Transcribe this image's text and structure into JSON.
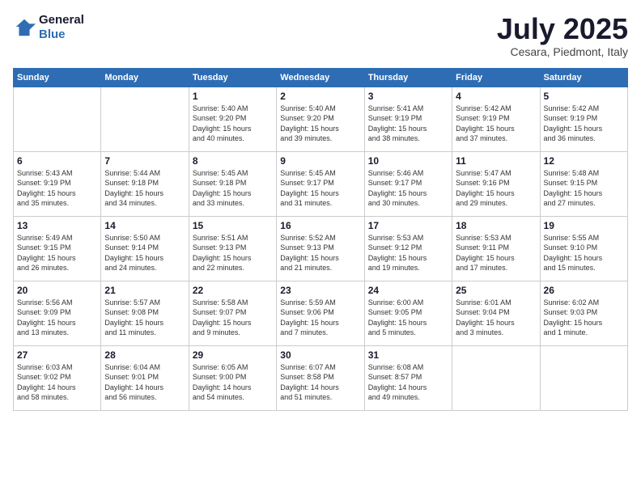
{
  "logo": {
    "line1": "General",
    "line2": "Blue"
  },
  "calendar": {
    "title": "July 2025",
    "subtitle": "Cesara, Piedmont, Italy"
  },
  "headers": [
    "Sunday",
    "Monday",
    "Tuesday",
    "Wednesday",
    "Thursday",
    "Friday",
    "Saturday"
  ],
  "weeks": [
    [
      {
        "day": "",
        "info": ""
      },
      {
        "day": "",
        "info": ""
      },
      {
        "day": "1",
        "info": "Sunrise: 5:40 AM\nSunset: 9:20 PM\nDaylight: 15 hours\nand 40 minutes."
      },
      {
        "day": "2",
        "info": "Sunrise: 5:40 AM\nSunset: 9:20 PM\nDaylight: 15 hours\nand 39 minutes."
      },
      {
        "day": "3",
        "info": "Sunrise: 5:41 AM\nSunset: 9:19 PM\nDaylight: 15 hours\nand 38 minutes."
      },
      {
        "day": "4",
        "info": "Sunrise: 5:42 AM\nSunset: 9:19 PM\nDaylight: 15 hours\nand 37 minutes."
      },
      {
        "day": "5",
        "info": "Sunrise: 5:42 AM\nSunset: 9:19 PM\nDaylight: 15 hours\nand 36 minutes."
      }
    ],
    [
      {
        "day": "6",
        "info": "Sunrise: 5:43 AM\nSunset: 9:19 PM\nDaylight: 15 hours\nand 35 minutes."
      },
      {
        "day": "7",
        "info": "Sunrise: 5:44 AM\nSunset: 9:18 PM\nDaylight: 15 hours\nand 34 minutes."
      },
      {
        "day": "8",
        "info": "Sunrise: 5:45 AM\nSunset: 9:18 PM\nDaylight: 15 hours\nand 33 minutes."
      },
      {
        "day": "9",
        "info": "Sunrise: 5:45 AM\nSunset: 9:17 PM\nDaylight: 15 hours\nand 31 minutes."
      },
      {
        "day": "10",
        "info": "Sunrise: 5:46 AM\nSunset: 9:17 PM\nDaylight: 15 hours\nand 30 minutes."
      },
      {
        "day": "11",
        "info": "Sunrise: 5:47 AM\nSunset: 9:16 PM\nDaylight: 15 hours\nand 29 minutes."
      },
      {
        "day": "12",
        "info": "Sunrise: 5:48 AM\nSunset: 9:15 PM\nDaylight: 15 hours\nand 27 minutes."
      }
    ],
    [
      {
        "day": "13",
        "info": "Sunrise: 5:49 AM\nSunset: 9:15 PM\nDaylight: 15 hours\nand 26 minutes."
      },
      {
        "day": "14",
        "info": "Sunrise: 5:50 AM\nSunset: 9:14 PM\nDaylight: 15 hours\nand 24 minutes."
      },
      {
        "day": "15",
        "info": "Sunrise: 5:51 AM\nSunset: 9:13 PM\nDaylight: 15 hours\nand 22 minutes."
      },
      {
        "day": "16",
        "info": "Sunrise: 5:52 AM\nSunset: 9:13 PM\nDaylight: 15 hours\nand 21 minutes."
      },
      {
        "day": "17",
        "info": "Sunrise: 5:53 AM\nSunset: 9:12 PM\nDaylight: 15 hours\nand 19 minutes."
      },
      {
        "day": "18",
        "info": "Sunrise: 5:53 AM\nSunset: 9:11 PM\nDaylight: 15 hours\nand 17 minutes."
      },
      {
        "day": "19",
        "info": "Sunrise: 5:55 AM\nSunset: 9:10 PM\nDaylight: 15 hours\nand 15 minutes."
      }
    ],
    [
      {
        "day": "20",
        "info": "Sunrise: 5:56 AM\nSunset: 9:09 PM\nDaylight: 15 hours\nand 13 minutes."
      },
      {
        "day": "21",
        "info": "Sunrise: 5:57 AM\nSunset: 9:08 PM\nDaylight: 15 hours\nand 11 minutes."
      },
      {
        "day": "22",
        "info": "Sunrise: 5:58 AM\nSunset: 9:07 PM\nDaylight: 15 hours\nand 9 minutes."
      },
      {
        "day": "23",
        "info": "Sunrise: 5:59 AM\nSunset: 9:06 PM\nDaylight: 15 hours\nand 7 minutes."
      },
      {
        "day": "24",
        "info": "Sunrise: 6:00 AM\nSunset: 9:05 PM\nDaylight: 15 hours\nand 5 minutes."
      },
      {
        "day": "25",
        "info": "Sunrise: 6:01 AM\nSunset: 9:04 PM\nDaylight: 15 hours\nand 3 minutes."
      },
      {
        "day": "26",
        "info": "Sunrise: 6:02 AM\nSunset: 9:03 PM\nDaylight: 15 hours\nand 1 minute."
      }
    ],
    [
      {
        "day": "27",
        "info": "Sunrise: 6:03 AM\nSunset: 9:02 PM\nDaylight: 14 hours\nand 58 minutes."
      },
      {
        "day": "28",
        "info": "Sunrise: 6:04 AM\nSunset: 9:01 PM\nDaylight: 14 hours\nand 56 minutes."
      },
      {
        "day": "29",
        "info": "Sunrise: 6:05 AM\nSunset: 9:00 PM\nDaylight: 14 hours\nand 54 minutes."
      },
      {
        "day": "30",
        "info": "Sunrise: 6:07 AM\nSunset: 8:58 PM\nDaylight: 14 hours\nand 51 minutes."
      },
      {
        "day": "31",
        "info": "Sunrise: 6:08 AM\nSunset: 8:57 PM\nDaylight: 14 hours\nand 49 minutes."
      },
      {
        "day": "",
        "info": ""
      },
      {
        "day": "",
        "info": ""
      }
    ]
  ]
}
